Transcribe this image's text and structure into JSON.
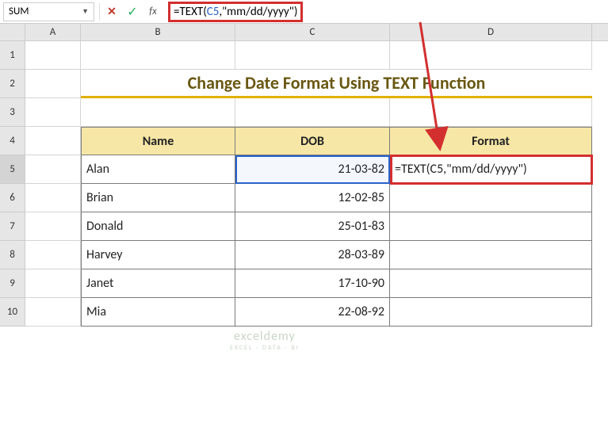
{
  "nameBox": {
    "value": "SUM"
  },
  "formulaBar": {
    "prefix": "=TEXT(",
    "ref": "C5",
    "suffix": ",\"mm/dd/yyyy\")"
  },
  "columns": [
    "A",
    "B",
    "C",
    "D"
  ],
  "rowNumbers": [
    "1",
    "2",
    "3",
    "4",
    "5",
    "6",
    "7",
    "8",
    "9",
    "10"
  ],
  "title": "Change Date Format Using TEXT Function",
  "tableHeaders": {
    "name": "Name",
    "dob": "DOB",
    "format": "Format"
  },
  "rows": [
    {
      "name": "Alan",
      "dob": "21-03-82",
      "format": "=TEXT(C5,\"mm/dd/yyyy\")"
    },
    {
      "name": "Brian",
      "dob": "12-02-85",
      "format": ""
    },
    {
      "name": "Donald",
      "dob": "25-01-83",
      "format": ""
    },
    {
      "name": "Harvey",
      "dob": "28-03-89",
      "format": ""
    },
    {
      "name": "Janet",
      "dob": "17-10-90",
      "format": ""
    },
    {
      "name": "Mia",
      "dob": "22-08-92",
      "format": ""
    }
  ],
  "watermark": {
    "line1": "exceldemy",
    "line2": "EXCEL · DATA · BI"
  },
  "chart_data": {
    "type": "table",
    "title": "Change Date Format Using TEXT Function",
    "columns": [
      "Name",
      "DOB",
      "Format"
    ],
    "rows": [
      [
        "Alan",
        "21-03-82",
        "=TEXT(C5,\"mm/dd/yyyy\")"
      ],
      [
        "Brian",
        "12-02-85",
        ""
      ],
      [
        "Donald",
        "25-01-83",
        ""
      ],
      [
        "Harvey",
        "28-03-89",
        ""
      ],
      [
        "Janet",
        "17-10-90",
        ""
      ],
      [
        "Mia",
        "22-08-92",
        ""
      ]
    ]
  }
}
